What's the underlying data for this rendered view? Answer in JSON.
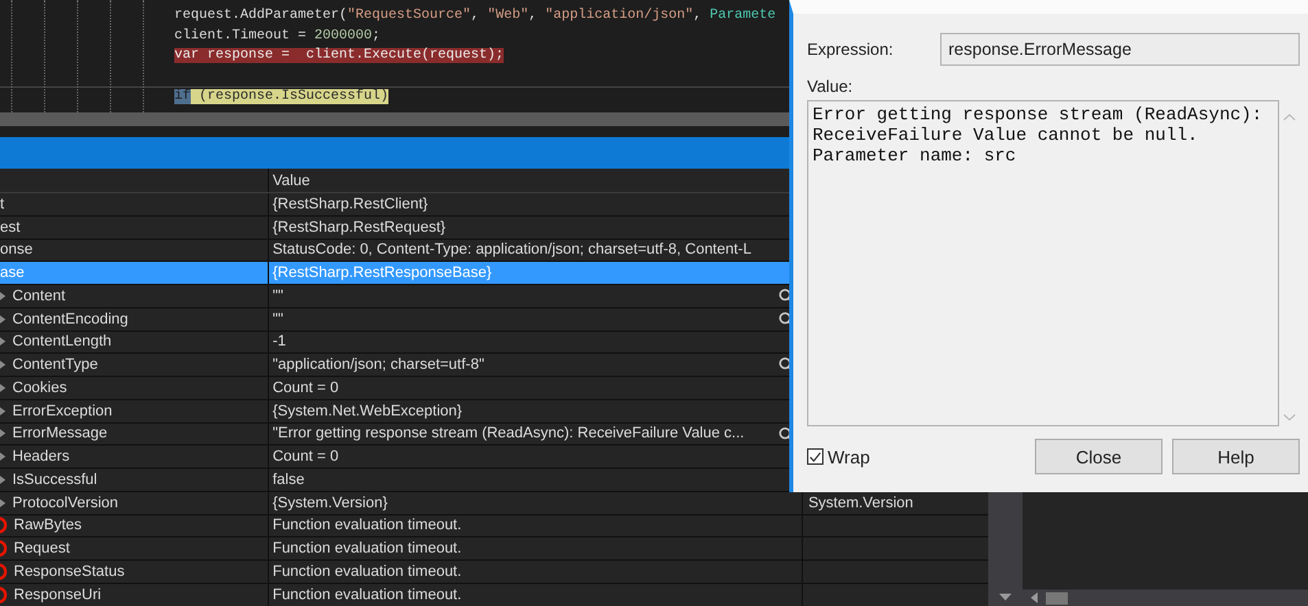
{
  "code": {
    "lines": [
      {
        "kind": "normal",
        "segments": [
          {
            "kind": "text",
            "text": "request.AddParameter("
          },
          {
            "kind": "string",
            "text": "\"RequestSource\""
          },
          {
            "kind": "text",
            "text": ", "
          },
          {
            "kind": "string",
            "text": "\"Web\""
          },
          {
            "kind": "text",
            "text": ", "
          },
          {
            "kind": "string",
            "text": "\"application/json\""
          },
          {
            "kind": "text",
            "text": ", "
          },
          {
            "kind": "type",
            "text": "Paramete"
          }
        ]
      },
      {
        "kind": "normal",
        "segments": [
          {
            "kind": "text",
            "text": "client.Timeout = "
          },
          {
            "kind": "number",
            "text": "2000000"
          },
          {
            "kind": "text",
            "text": ";"
          }
        ]
      },
      {
        "kind": "breakpoint",
        "segments": [
          {
            "kind": "text",
            "text": "var response =  client.Execute(request);"
          }
        ]
      },
      {
        "kind": "blank"
      },
      {
        "kind": "current",
        "segments": [
          {
            "kind": "keyword",
            "text": "if"
          },
          {
            "kind": "text",
            "text": " (response.IsSuccessful)"
          }
        ]
      }
    ]
  },
  "watch": {
    "columns": [
      "Value"
    ],
    "rows": [
      {
        "name": "t",
        "value": "{RestSharp.RestClient}",
        "selected": false,
        "magnifier": false
      },
      {
        "name": "est",
        "value": "{RestSharp.RestRequest}",
        "selected": false,
        "magnifier": false
      },
      {
        "name": "onse",
        "value": "StatusCode: 0, Content-Type: application/json; charset=utf-8, Content-L",
        "selected": false,
        "magnifier": false
      },
      {
        "name": "ase",
        "value": "{RestSharp.RestResponseBase}",
        "selected": true,
        "magnifier": false,
        "children": [
          {
            "kind": "property",
            "name": "Content",
            "value": "\"\"",
            "selected": false,
            "magnifier": true
          },
          {
            "kind": "property",
            "name": "ContentEncoding",
            "value": "\"\"",
            "selected": false,
            "magnifier": true
          },
          {
            "kind": "property",
            "name": "ContentLength",
            "value": "-1",
            "selected": false,
            "magnifier": false
          },
          {
            "kind": "property",
            "name": "ContentType",
            "value": "\"application/json; charset=utf-8\"",
            "selected": false,
            "magnifier": true
          },
          {
            "kind": "property",
            "name": "Cookies",
            "value": "Count = 0",
            "selected": false,
            "magnifier": false
          },
          {
            "kind": "property",
            "name": "ErrorException",
            "value": "{System.Net.WebException}",
            "selected": false,
            "magnifier": false
          },
          {
            "kind": "property",
            "name": "ErrorMessage",
            "value": "\"Error getting response stream (ReadAsync): ReceiveFailure Value c...",
            "selected": false,
            "magnifier": true
          },
          {
            "kind": "property",
            "name": "Headers",
            "value": "Count = 0",
            "selected": false,
            "magnifier": false
          },
          {
            "kind": "property",
            "name": "IsSuccessful",
            "value": "false",
            "selected": false,
            "magnifier": false
          },
          {
            "kind": "property",
            "name": "ProtocolVersion",
            "value": "{System.Version}",
            "type": "System.Version",
            "selected": false,
            "magnifier": false
          },
          {
            "kind": "error",
            "name": "RawBytes",
            "value": "Function evaluation timeout.",
            "selected": false,
            "magnifier": false
          },
          {
            "kind": "error",
            "name": "Request",
            "value": "Function evaluation timeout.",
            "selected": false,
            "magnifier": false
          },
          {
            "kind": "error",
            "name": "ResponseStatus",
            "value": "Function evaluation timeout.",
            "selected": false,
            "magnifier": false
          },
          {
            "kind": "error",
            "name": "ResponseUri",
            "value": "Function evaluation timeout.",
            "selected": false,
            "magnifier": false
          }
        ]
      }
    ]
  },
  "dialog": {
    "expression_label": "Expression:",
    "expression": "response.ErrorMessage",
    "value_label": "Value:",
    "value": "Error getting response stream (ReadAsync): ReceiveFailure Value cannot be null.\nParameter name: src",
    "wrap": {
      "label": "Wrap",
      "checked": true
    },
    "buttons": [
      "Close",
      "Help"
    ]
  }
}
